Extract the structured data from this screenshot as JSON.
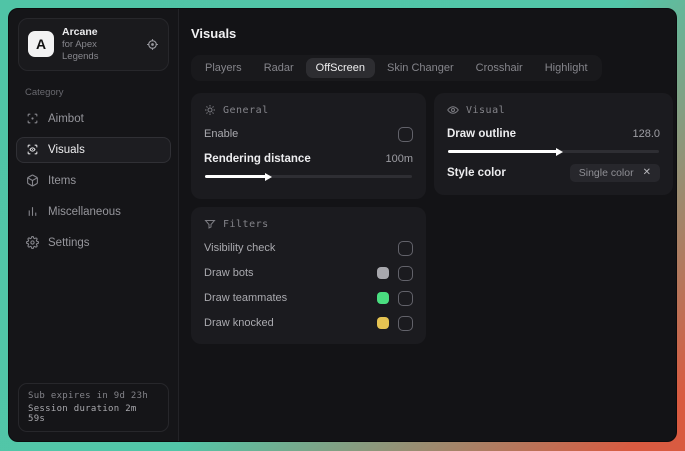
{
  "sidebar": {
    "logo_letter": "A",
    "app_name": "Arcane",
    "app_subtitle": "for Apex Legends",
    "category_label": "Category",
    "items": [
      {
        "label": "Aimbot"
      },
      {
        "label": "Visuals"
      },
      {
        "label": "Items"
      },
      {
        "label": "Miscellaneous"
      },
      {
        "label": "Settings"
      }
    ],
    "footer": {
      "sub_expires": "Sub expires in 9d 23h",
      "session_duration": "Session duration 2m 59s"
    }
  },
  "main": {
    "title": "Visuals",
    "tabs": [
      {
        "label": "Players"
      },
      {
        "label": "Radar"
      },
      {
        "label": "OffScreen"
      },
      {
        "label": "Skin Changer"
      },
      {
        "label": "Crosshair"
      },
      {
        "label": "Highlight"
      }
    ],
    "general": {
      "title": "General",
      "enable_label": "Enable",
      "enable_checked": false,
      "rendering_distance_label": "Rendering distance",
      "rendering_distance_value": "100m",
      "rendering_distance_percent": 30
    },
    "visual": {
      "title": "Visual",
      "draw_outline_label": "Draw outline",
      "draw_outline_value": "128.0",
      "draw_outline_percent": 52,
      "style_color_label": "Style color",
      "style_color_value": "Single color",
      "style_color_clear": "✕"
    },
    "filters": {
      "title": "Filters",
      "rows": [
        {
          "label": "Visibility check",
          "swatch": null,
          "checked": false
        },
        {
          "label": "Draw bots",
          "swatch": "#a8a8ad",
          "checked": false
        },
        {
          "label": "Draw teammates",
          "swatch": "#4ade80",
          "checked": false
        },
        {
          "label": "Draw knocked",
          "swatch": "#e5c352",
          "checked": false
        }
      ]
    }
  },
  "colors": {
    "desktop_teal": "#52c6a8",
    "desktop_red": "#d95b41",
    "window_bg": "#131316",
    "card_bg": "#1b1b1f",
    "swatch_gray": "#a8a8ad",
    "swatch_green": "#4ade80",
    "swatch_yellow": "#e5c352"
  }
}
